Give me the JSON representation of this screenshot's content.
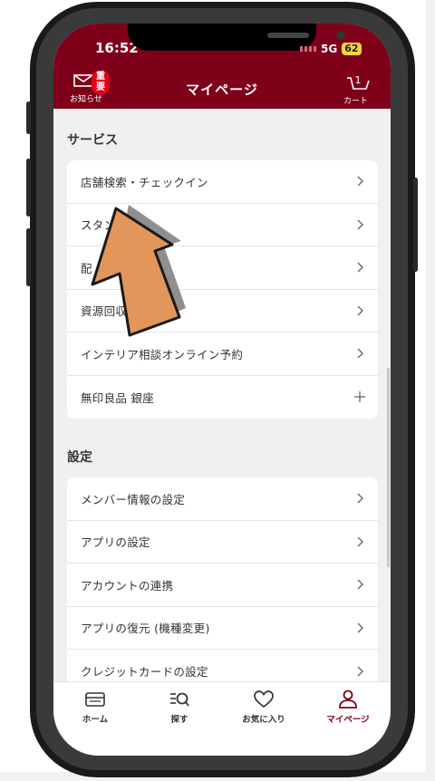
{
  "status": {
    "time": "16:52",
    "network": "5G",
    "battery": "62"
  },
  "header": {
    "title": "マイページ",
    "notice_label": "お知らせ",
    "notice_badge": "重要",
    "cart_label": "カート",
    "cart_count": "1",
    "color": "#7f0019"
  },
  "services": {
    "title": "サービス",
    "items": [
      {
        "label": "店舗検索・チェックイン",
        "icon": "chevron-right"
      },
      {
        "label": "スタン",
        "icon": "chevron-right"
      },
      {
        "label": "配",
        "icon": "chevron-right"
      },
      {
        "label": "資源回収",
        "icon": "chevron-right"
      },
      {
        "label": "インテリア相談オンライン予約",
        "icon": "chevron-right"
      },
      {
        "label": "無印良品 銀座",
        "icon": "plus"
      }
    ]
  },
  "settings": {
    "title": "設定",
    "items": [
      {
        "label": "メンバー情報の設定",
        "icon": "chevron-right"
      },
      {
        "label": "アプリの設定",
        "icon": "chevron-right"
      },
      {
        "label": "アカウントの連携",
        "icon": "chevron-right"
      },
      {
        "label": "アプリの復元 (機種変更)",
        "icon": "chevron-right"
      },
      {
        "label": "クレジットカードの設定",
        "icon": "chevron-right"
      }
    ]
  },
  "tabbar": {
    "items": [
      {
        "label": "ホーム",
        "icon": "card-icon"
      },
      {
        "label": "探す",
        "icon": "search-icon"
      },
      {
        "label": "お気に入り",
        "icon": "heart-icon"
      },
      {
        "label": "マイページ",
        "icon": "person-icon",
        "active": true
      }
    ]
  },
  "colors": {
    "accent": "#7f0019",
    "arrow": "#e3965a"
  }
}
